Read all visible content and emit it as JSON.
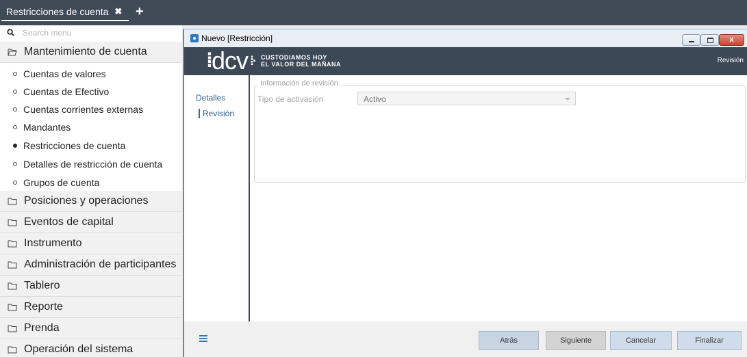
{
  "top_tab": {
    "label": "Restricciones de cuenta",
    "close_glyph": "✖",
    "add_glyph": "+"
  },
  "sidebar": {
    "search_placeholder": "Search menu",
    "expanded_section": "Mantenimiento de cuenta",
    "sub_items": [
      {
        "label": "Cuentas de valores",
        "active": false
      },
      {
        "label": "Cuentas de Efectivo",
        "active": false
      },
      {
        "label": "Cuentas corrientes externas",
        "active": false
      },
      {
        "label": "Mandantes",
        "active": false
      },
      {
        "label": "Restricciones de cuenta",
        "active": true
      },
      {
        "label": "Detalles de restricción de cuenta",
        "active": false
      },
      {
        "label": "Grupos de cuenta",
        "active": false
      }
    ],
    "sections": [
      "Posiciones y operaciones",
      "Eventos de capital",
      "Instrumento",
      "Administración de participantes",
      "Tablero",
      "Reporte",
      "Prenda",
      "Operación del sistema"
    ]
  },
  "window": {
    "title": "Nuevo [Restricción]",
    "close_glyph": "x",
    "banner": {
      "logo_text": "dcv",
      "tagline_line1": "CUSTODIAMOS HOY",
      "tagline_line2": "EL VALOR DEL MAÑANA",
      "right_label": "Revisión"
    },
    "nav": [
      "Detalles",
      "Revisión"
    ],
    "fieldset_legend": "Información de revisión",
    "field_label": "Tipo de activación",
    "field_value": "Activo",
    "buttons": {
      "back": "Atrás",
      "next": "Siguiente",
      "cancel": "Cancelar",
      "finish": "Finalizar"
    }
  },
  "colors": {
    "topbar": "#3f4a56",
    "banner": "#3c4856",
    "accent": "#2e79c1"
  }
}
